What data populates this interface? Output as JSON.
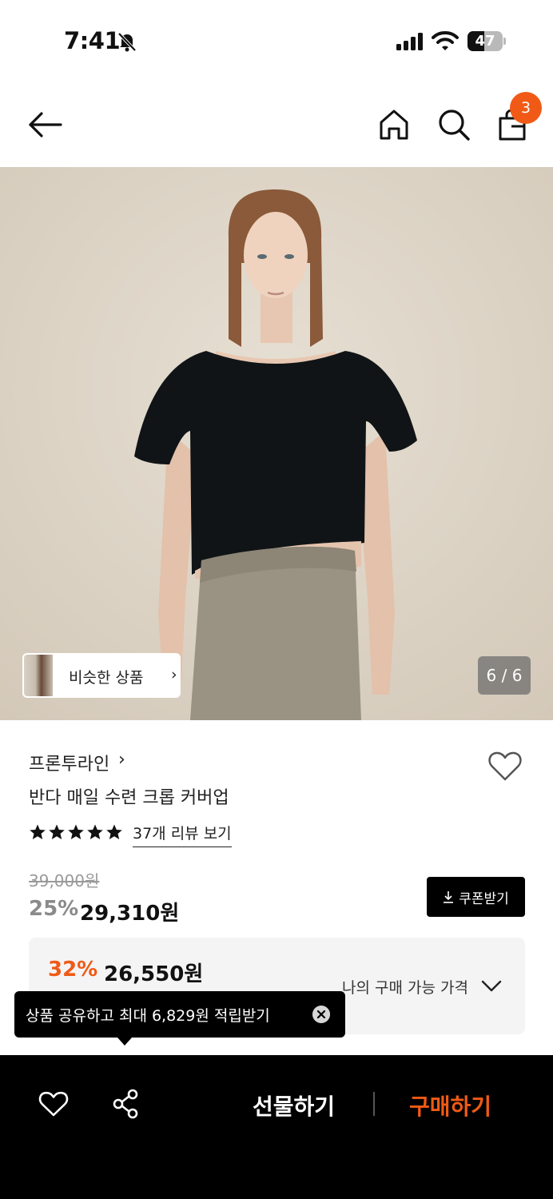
{
  "status_bar": {
    "time": "7:41",
    "battery": "47",
    "battery_level": 0.47
  },
  "header": {
    "cart_count": "3"
  },
  "gallery": {
    "similar_label": "비슷한 상품",
    "counter": "6 / 6"
  },
  "product": {
    "brand": "프론투라인",
    "name": "반다 매일 수련 크롭 커버업",
    "rating": 5,
    "reviews_link": "37개 리뷰 보기",
    "original_price": "39,000원",
    "discount": "25%",
    "price": "29,310원",
    "coupon_button": "쿠폰받기"
  },
  "my_price": {
    "discount": "32%",
    "price": "26,550원",
    "label": "나의 구매 가능 가격"
  },
  "tooltip": {
    "text": "상품 공유하고 최대 6,829원 적립받기"
  },
  "bottom_bar": {
    "gift_label": "선물하기",
    "buy_label": "구매하기"
  },
  "colors": {
    "accent": "#f05a16",
    "dark": "#000000",
    "panel": "#f4f4f4"
  },
  "icons": [
    "bell-slash-icon",
    "signal-icon",
    "wifi-icon",
    "battery-icon",
    "back-arrow-icon",
    "home-icon",
    "search-icon",
    "shopping-bag-icon",
    "chevron-right-icon",
    "heart-icon",
    "star-icon",
    "download-icon",
    "chevron-down-icon",
    "close-icon",
    "share-icon"
  ]
}
